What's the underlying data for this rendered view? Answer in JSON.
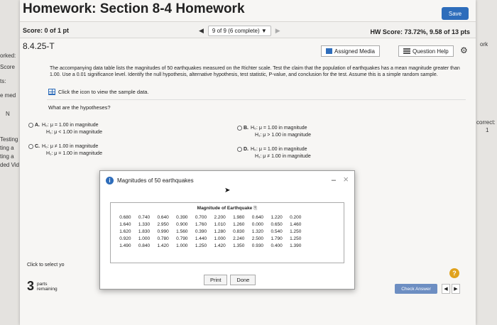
{
  "header": {
    "title": "Homework: Section 8-4 Homework",
    "save_label": "Save"
  },
  "topbar": {
    "score": "Score: 0 of 1 pt",
    "question_position": "9 of 9 (6 complete)",
    "hw_score": "HW Score: 73.72%, 9.58 of 13 pts"
  },
  "subbar": {
    "question_id": "8.4.25-T",
    "assigned_media": "Assigned Media",
    "question_help": "Question Help"
  },
  "left_strip": [
    "orked:",
    "Score",
    "ts:",
    "e med",
    "N",
    "Testing",
    "ting a",
    "ting a",
    "ded Vid"
  ],
  "right_strip": [
    "ork",
    "correct:",
    "1"
  ],
  "prompt": {
    "text": "The accompanying data table lists the magnitudes of 50 earthquakes measured on the Richter scale. Test the claim that the population of earthquakes has a mean magnitude greater than 1.00. Use a 0.01 significance level. Identify the null hypothesis, alternative hypothesis, test statistic, P-value, and conclusion for the test. Assume this is a simple random sample.",
    "data_link": "Click the icon to view the sample data.",
    "question": "What are the hypotheses?"
  },
  "options": [
    {
      "letter": "A.",
      "h0": "H₀: μ = 1.00 in magnitude",
      "h1": "H₁: μ < 1.00 in magnitude"
    },
    {
      "letter": "B.",
      "h0": "H₀: μ = 1.00 in magnitude",
      "h1": "H₁: μ > 1.00 in magnitude"
    },
    {
      "letter": "C.",
      "h0": "H₀: μ ≠ 1.00 in magnitude",
      "h1": "H₁: μ = 1.00 in magnitude"
    },
    {
      "letter": "D.",
      "h0": "H₀: μ = 1.00 in magnitude",
      "h1": "H₁: μ ≠ 1.00 in magnitude"
    }
  ],
  "footer": {
    "click_select": "Click to select yo",
    "parts_count": "3",
    "parts_label_1": "parts",
    "parts_label_2": "remaining",
    "check_answer": "Check Answer",
    "help": "?"
  },
  "modal": {
    "title": "Magnitudes of 50 earthquakes",
    "table_title": "Magnitude of Earthquake",
    "rows": [
      [
        "0.680",
        "0.740",
        "0.640",
        "0.390",
        "0.700",
        "2.200",
        "1.980",
        "0.640",
        "1.220",
        "0.200"
      ],
      [
        "1.640",
        "1.330",
        "2.950",
        "0.900",
        "1.760",
        "1.010",
        "1.260",
        "0.000",
        "0.650",
        "1.460"
      ],
      [
        "1.620",
        "1.830",
        "0.990",
        "1.560",
        "0.390",
        "1.280",
        "0.830",
        "1.320",
        "0.540",
        "1.250"
      ],
      [
        "0.920",
        "1.000",
        "0.780",
        "0.790",
        "1.440",
        "1.000",
        "2.240",
        "2.500",
        "1.790",
        "1.250"
      ],
      [
        "1.490",
        "0.840",
        "1.420",
        "1.000",
        "1.250",
        "1.420",
        "1.350",
        "0.930",
        "0.400",
        "1.390"
      ]
    ],
    "print_label": "Print",
    "done_label": "Done"
  },
  "icons": [
    "prev-arrow-icon",
    "dropdown-icon",
    "next-arrow-icon",
    "assigned-media-icon",
    "list-icon",
    "gear-icon",
    "grid-icon",
    "info-icon",
    "minimize-icon",
    "close-icon",
    "copy-icon",
    "cursor-icon"
  ],
  "colors": {
    "accent": "#2e6dbb",
    "help": "#e0a21d",
    "check": "#6d8ec2"
  }
}
